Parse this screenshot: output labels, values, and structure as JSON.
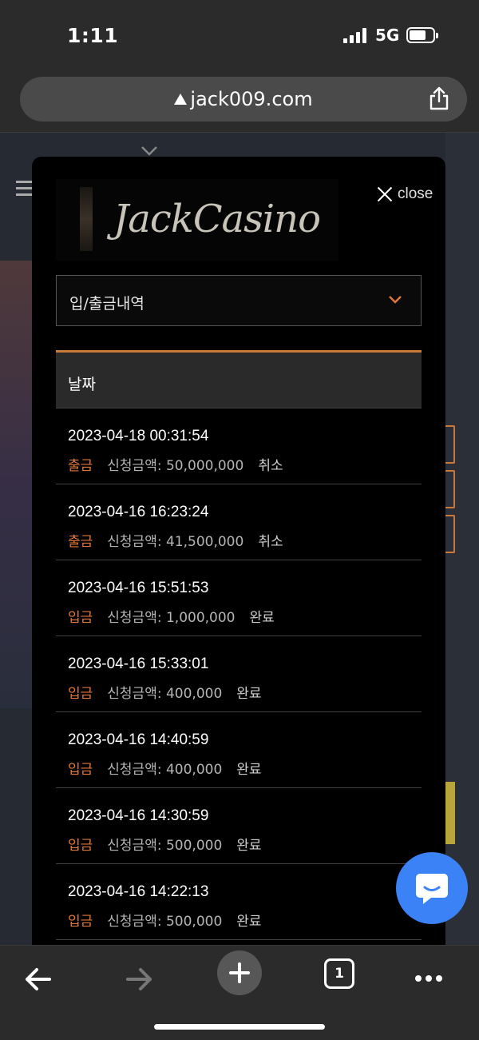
{
  "status_bar": {
    "time": "1:11",
    "network": "5G"
  },
  "browser": {
    "url": "jack009.com",
    "tab_count": "1"
  },
  "modal": {
    "logo_text": "JackCasino",
    "close_label": "close",
    "select_value": "입/출금내역",
    "table_header": "날짜",
    "transactions": [
      {
        "datetime": "2023-04-18 00:31:54",
        "type": "출금",
        "amount": "신청금액: 50,000,000",
        "status": "취소"
      },
      {
        "datetime": "2023-04-16 16:23:24",
        "type": "출금",
        "amount": "신청금액: 41,500,000",
        "status": "취소"
      },
      {
        "datetime": "2023-04-16 15:51:53",
        "type": "입금",
        "amount": "신청금액: 1,000,000",
        "status": "완료"
      },
      {
        "datetime": "2023-04-16 15:33:01",
        "type": "입금",
        "amount": "신청금액: 400,000",
        "status": "완료"
      },
      {
        "datetime": "2023-04-16 14:40:59",
        "type": "입금",
        "amount": "신청금액: 400,000",
        "status": "완료"
      },
      {
        "datetime": "2023-04-16 14:30:59",
        "type": "입금",
        "amount": "신청금액: 500,000",
        "status": "완료"
      },
      {
        "datetime": "2023-04-16 14:22:13",
        "type": "입금",
        "amount": "신청금액: 500,000",
        "status": "완료"
      }
    ]
  },
  "colors": {
    "accent": "#c7793a",
    "type_text": "#e0773a",
    "chat": "#3b82f6"
  }
}
